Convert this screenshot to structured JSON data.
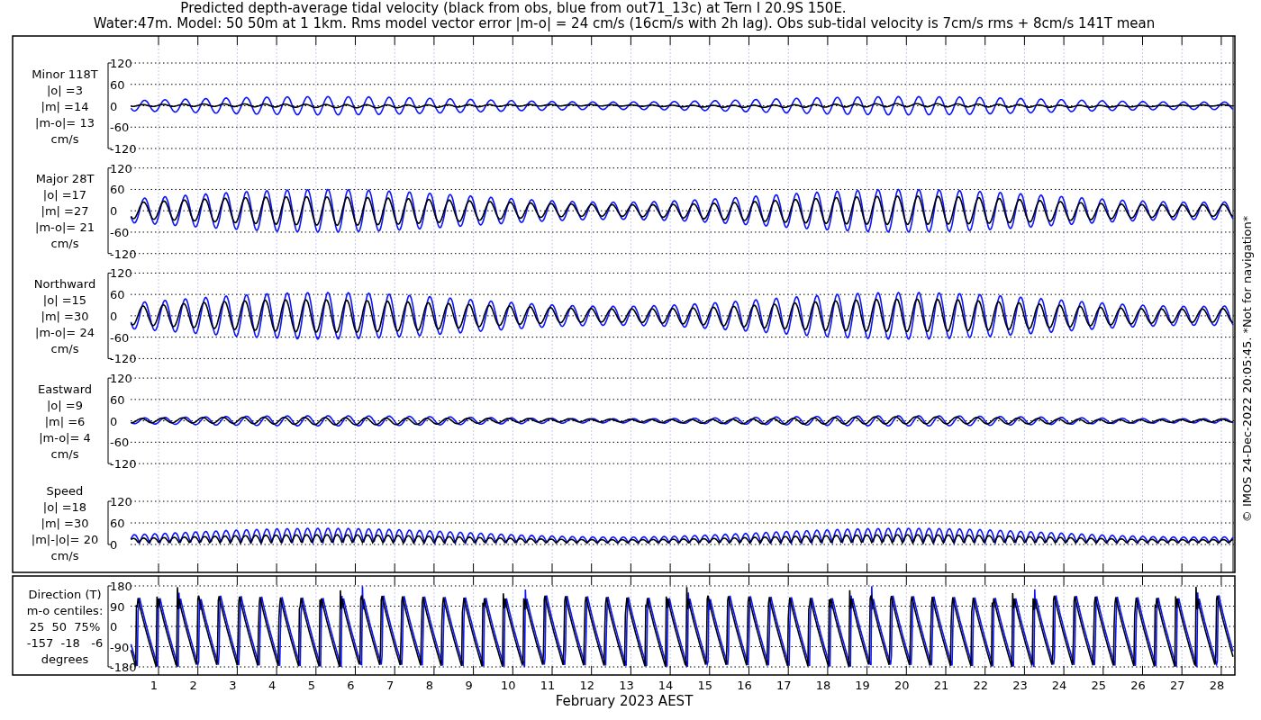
{
  "title": "Predicted depth-average tidal velocity (black from obs, blue from out71_13c) at Tern I 20.9S 150E.",
  "subtitle": "Water:47m. Model: 50 50m at 1 1km. Rms model vector error |m-o| = 24 cm/s (16cm/s with 2h lag). Obs sub-tidal velocity is 7cm/s rms + 8cm/s 141T mean",
  "panels": [
    {
      "kind": "velocity",
      "label_lines": [
        "Minor 118T",
        "|o| =3",
        "|m| =14",
        "|m-o|= 13",
        "cm/s"
      ],
      "y_ticks": [
        "120",
        "60",
        "0",
        "-60",
        "-120"
      ]
    },
    {
      "kind": "velocity",
      "label_lines": [
        "Major 28T",
        "|o| =17",
        "|m| =27",
        "|m-o|= 21",
        "cm/s"
      ],
      "y_ticks": [
        "120",
        "60",
        "0",
        "-60",
        "-120"
      ]
    },
    {
      "kind": "velocity",
      "label_lines": [
        "Northward",
        "|o| =15",
        "|m| =30",
        "|m-o|= 24",
        "cm/s"
      ],
      "y_ticks": [
        "120",
        "60",
        "0",
        "-60",
        "-120"
      ]
    },
    {
      "kind": "velocity",
      "label_lines": [
        "Eastward",
        "|o| =9",
        "|m| =6",
        "|m-o|= 4",
        "cm/s"
      ],
      "y_ticks": [
        "120",
        "60",
        "0",
        "-60",
        "-120"
      ]
    },
    {
      "kind": "speed",
      "label_lines": [
        "Speed",
        "|o| =18",
        "|m| =30",
        "|m|-|o|= 20",
        "cm/s"
      ],
      "y_ticks": [
        "120",
        "60",
        "0"
      ]
    },
    {
      "kind": "direction",
      "label_lines": [
        "Direction (T)",
        "m-o centiles:",
        "25  50  75%",
        "-157  -18   -6",
        "degrees"
      ],
      "y_ticks": [
        "180",
        "90",
        "0",
        "-90",
        "-180"
      ]
    }
  ],
  "x_ticks": [
    "1",
    "2",
    "3",
    "4",
    "5",
    "6",
    "7",
    "8",
    "9",
    "10",
    "11",
    "12",
    "13",
    "14",
    "15",
    "16",
    "17",
    "18",
    "19",
    "20",
    "21",
    "22",
    "23",
    "24",
    "25",
    "26",
    "27",
    "28"
  ],
  "xlabel": "February 2023 AEST",
  "footer": "© IMOS 24-Dec-2022 20:05:45. *Not for navigation*"
}
